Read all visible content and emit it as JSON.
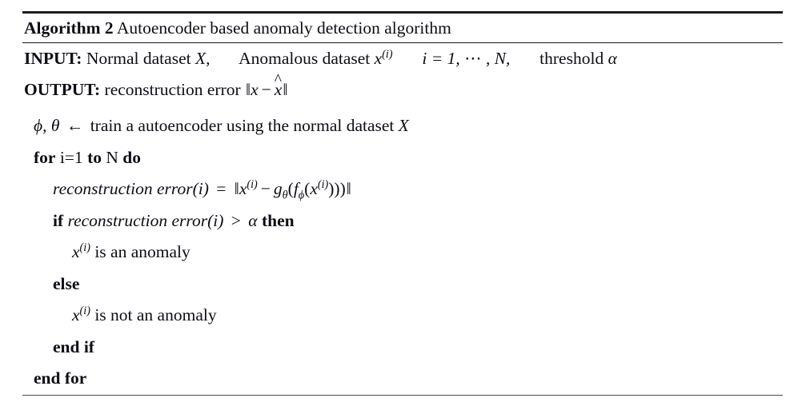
{
  "algorithm": {
    "title": {
      "keyword": "Algorithm",
      "number": "2",
      "description": "Autoencoder based anomaly detection algorithm"
    },
    "io": {
      "input_label": "INPUT:",
      "input_part1": "Normal dataset",
      "input_var1": "X,",
      "input_part2": "Anomalous dataset",
      "input_var2": "x",
      "input_var2_sup": "(i)",
      "input_index": "i = 1,",
      "input_dots": "⋯",
      "input_index_end": ", N,",
      "input_part3": "threshold",
      "input_alpha": "α",
      "output_label": "OUTPUT:",
      "output_text": "reconstruction error",
      "output_norm_open": "‖",
      "output_x": "x",
      "output_minus": "−",
      "output_xhat": "x",
      "output_norm_close": "‖"
    },
    "lines": [
      {
        "id": "train-line",
        "indent": 1,
        "phi": "ϕ,",
        "theta": "θ",
        "arrow": "←",
        "text": "train a autoencoder using the normal dataset",
        "var": "X"
      },
      {
        "id": "for-line",
        "indent": 1,
        "kw_for": "for",
        "counter": "i=1",
        "kw_to": "to",
        "bound": "N",
        "kw_do": "do"
      },
      {
        "id": "reconstruction-error-line",
        "indent": 2,
        "expr_name": "reconstruction error",
        "expr_arg": "(i)",
        "equals": "=",
        "norm_open": "‖",
        "x": "x",
        "x_sup": "(i)",
        "minus": "−",
        "g": "g",
        "g_sub": "θ",
        "f": "f",
        "f_sub": "ϕ",
        "inner_x": "x",
        "inner_sup": "(i)",
        "closers": ")))",
        "norm_close": "‖"
      },
      {
        "id": "if-line",
        "indent": 2,
        "kw_if": "if",
        "expr_name": "reconstruction error",
        "expr_arg": "(i)",
        "gt": ">",
        "alpha": "α",
        "kw_then": "then"
      },
      {
        "id": "anomaly-line",
        "indent": 3,
        "x": "x",
        "x_sup": "(i)",
        "text": "is an anomaly"
      },
      {
        "id": "else-line",
        "indent": 2,
        "kw_else": "else"
      },
      {
        "id": "not-anomaly-line",
        "indent": 3,
        "x": "x",
        "x_sup": "(i)",
        "text": "is not an anomaly"
      },
      {
        "id": "end-if-line",
        "indent": 2,
        "kw_end_if": "end if"
      },
      {
        "id": "end-for-line",
        "indent": 1,
        "kw_end_for": "end for"
      }
    ]
  }
}
